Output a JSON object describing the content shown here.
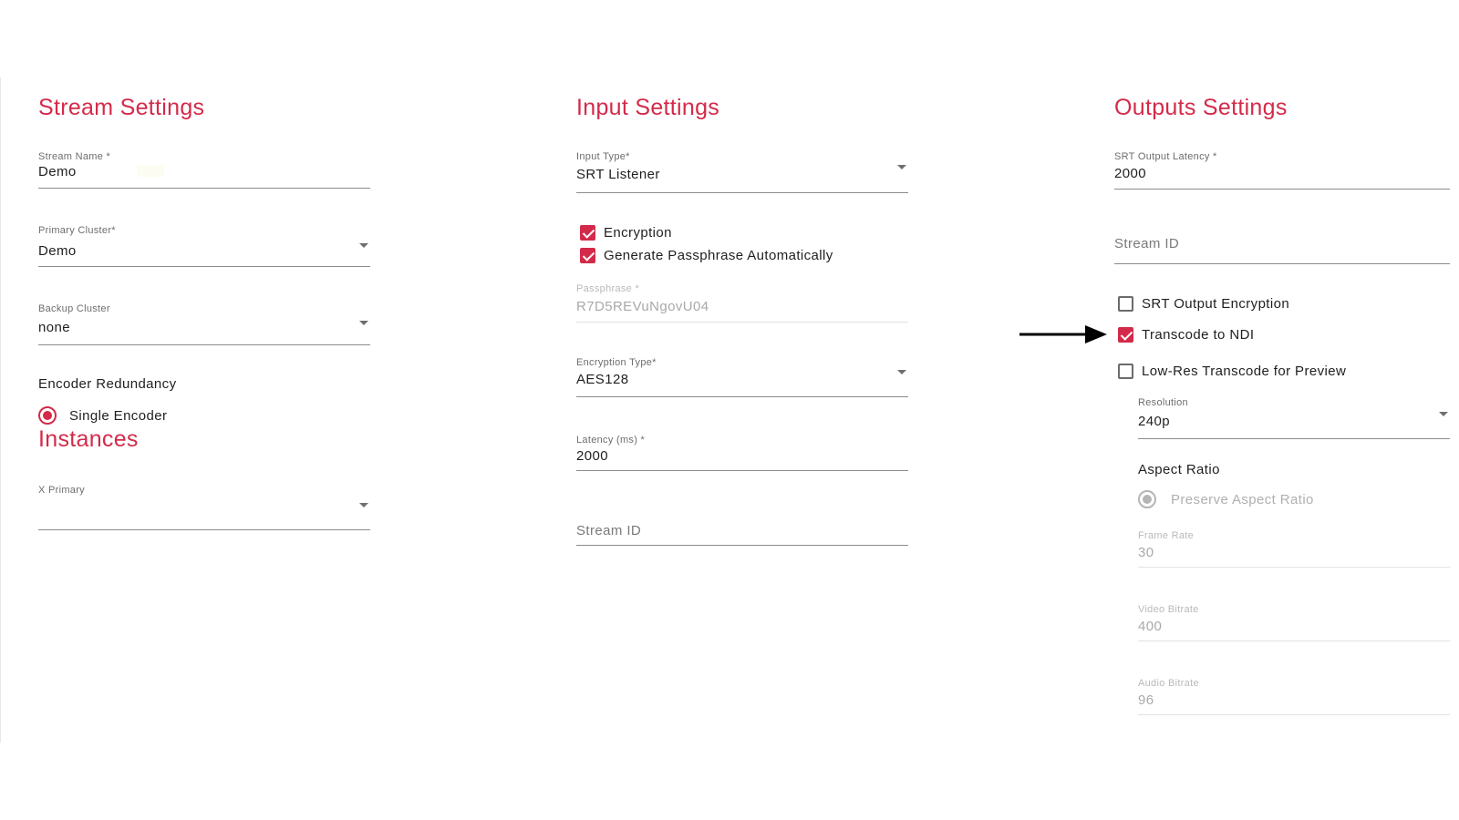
{
  "stream_settings": {
    "title": "Stream Settings",
    "stream_name": {
      "label": "Stream Name *",
      "value": "Demo"
    },
    "primary_cluster": {
      "label": "Primary Cluster*",
      "value": "Demo"
    },
    "backup_cluster": {
      "label": "Backup Cluster",
      "value": "none"
    },
    "encoder_redundancy": {
      "label": "Encoder Redundancy",
      "option": "Single Encoder",
      "selected": true
    }
  },
  "instances": {
    "title": "Instances",
    "x_primary": {
      "label": "X Primary",
      "value": ""
    }
  },
  "input_settings": {
    "title": "Input Settings",
    "input_type": {
      "label": "Input Type*",
      "value": "SRT Listener"
    },
    "encryption": {
      "label": "Encryption",
      "checked": true
    },
    "generate_passphrase": {
      "label": "Generate Passphrase Automatically",
      "checked": true
    },
    "passphrase": {
      "label": "Passphrase *",
      "value": "R7D5REVuNgovU04",
      "disabled": true
    },
    "encryption_type": {
      "label": "Encryption Type*",
      "value": "AES128"
    },
    "latency": {
      "label": "Latency (ms) *",
      "value": "2000"
    },
    "stream_id": {
      "placeholder": "Stream ID"
    }
  },
  "outputs_settings": {
    "title": "Outputs Settings",
    "srt_output_latency": {
      "label": "SRT Output Latency *",
      "value": "2000"
    },
    "stream_id": {
      "placeholder": "Stream ID"
    },
    "srt_output_encryption": {
      "label": "SRT Output Encryption",
      "checked": false
    },
    "transcode_to_ndi": {
      "label": "Transcode to NDI",
      "checked": true
    },
    "low_res_transcode": {
      "label": "Low-Res Transcode for Preview",
      "checked": false
    },
    "resolution": {
      "label": "Resolution",
      "value": "240p"
    },
    "aspect_ratio": {
      "label": "Aspect Ratio",
      "option": "Preserve Aspect Ratio",
      "selected": true,
      "disabled": true
    },
    "frame_rate": {
      "label": "Frame Rate",
      "value": "30",
      "disabled": true
    },
    "video_bitrate": {
      "label": "Video Bitrate",
      "value": "400",
      "disabled": true
    },
    "audio_bitrate": {
      "label": "Audio Bitrate",
      "value": "96",
      "disabled": true
    }
  },
  "annotation": {
    "icon": "arrow-right-icon",
    "color": "#000000"
  },
  "theme": {
    "accent": "#d42a4a"
  }
}
